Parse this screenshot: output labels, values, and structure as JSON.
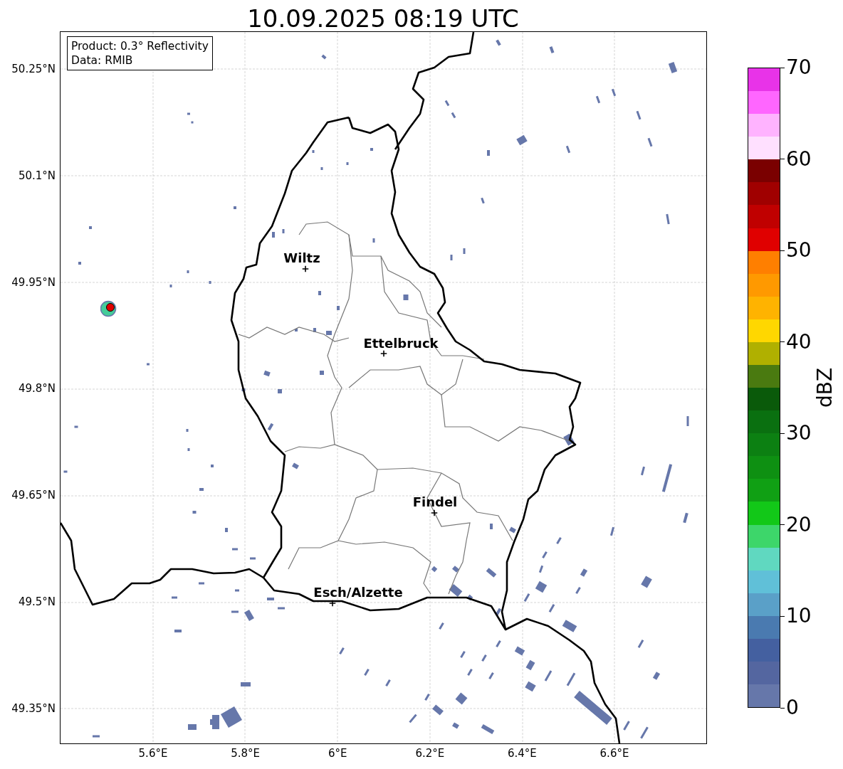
{
  "title": "10.09.2025 08:19 UTC",
  "info_box": [
    "Product: 0.3° Reflectivity",
    "Data: RMIB"
  ],
  "map": {
    "latitude_ticks": [
      "50.25°N",
      "50.1°N",
      "49.95°N",
      "49.8°N",
      "49.65°N",
      "49.5°N",
      "49.35°N"
    ],
    "longitude_ticks": [
      "5.6°E",
      "5.8°E",
      "6°E",
      "6.2°E",
      "6.4°E",
      "6.6°E"
    ],
    "cities": [
      {
        "name": "Wiltz"
      },
      {
        "name": "Ettelbruck"
      },
      {
        "name": "Findel"
      },
      {
        "name": "Esch/Alzette"
      }
    ]
  },
  "colorbar": {
    "label": "dBZ",
    "ticks": [
      "70",
      "60",
      "50",
      "40",
      "30",
      "20",
      "10",
      "0"
    ],
    "bands": [
      {
        "color": "#e833e8"
      },
      {
        "color": "#ff66ff"
      },
      {
        "color": "#ffb3ff"
      },
      {
        "color": "#ffe0ff"
      },
      {
        "color": "#7a0000"
      },
      {
        "color": "#a00000"
      },
      {
        "color": "#c00000"
      },
      {
        "color": "#e00000"
      },
      {
        "color": "#ff7f00"
      },
      {
        "color": "#ff9900"
      },
      {
        "color": "#ffb300"
      },
      {
        "color": "#ffd700"
      },
      {
        "color": "#b0b000"
      },
      {
        "color": "#4a7a10"
      },
      {
        "color": "#0a5a0a"
      },
      {
        "color": "#0a7010"
      },
      {
        "color": "#0c8012"
      },
      {
        "color": "#0e9012"
      },
      {
        "color": "#10a014"
      },
      {
        "color": "#12c818"
      },
      {
        "color": "#3dd66a"
      },
      {
        "color": "#60d8c0"
      },
      {
        "color": "#60c0d8"
      },
      {
        "color": "#5aa0c8"
      },
      {
        "color": "#4a7ab0"
      },
      {
        "color": "#4460a0"
      },
      {
        "color": "#5466a0"
      },
      {
        "color": "#6677aa"
      }
    ]
  }
}
